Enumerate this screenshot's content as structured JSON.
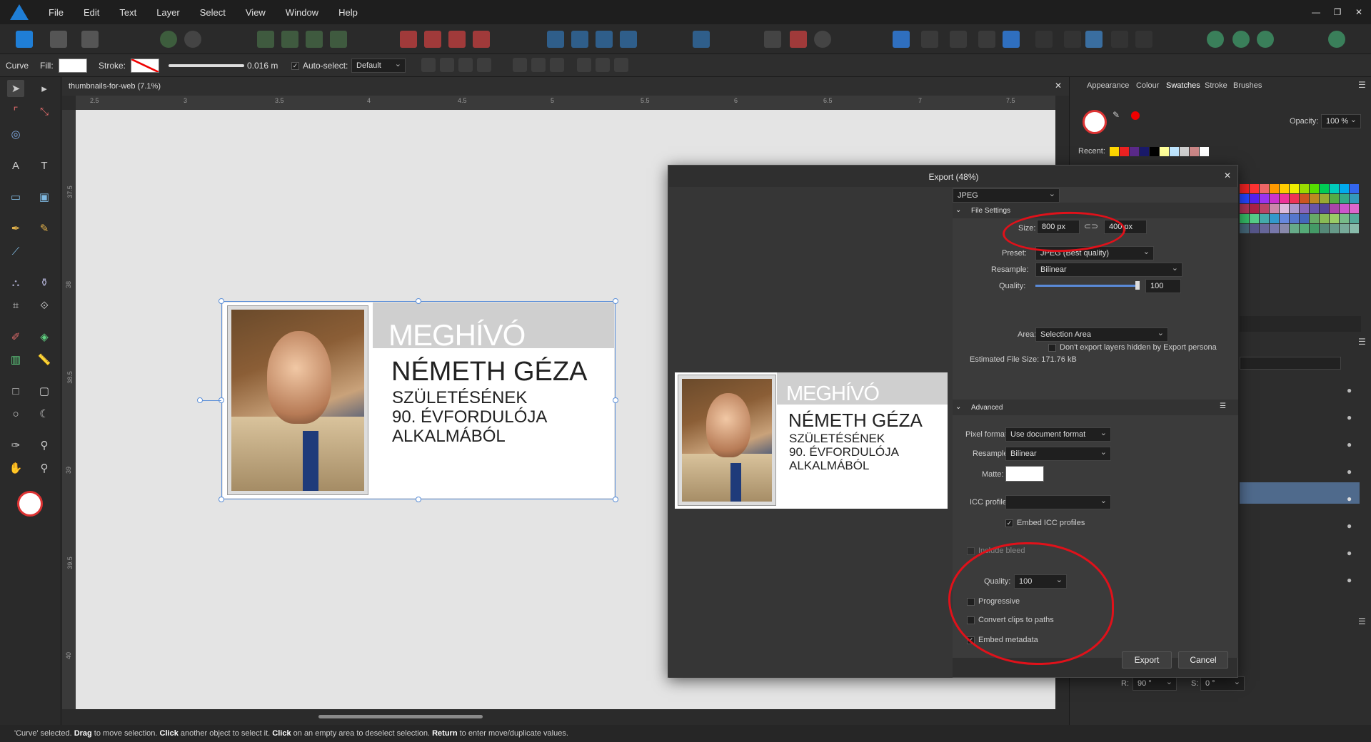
{
  "menubar": {
    "items": [
      "File",
      "Edit",
      "Text",
      "Layer",
      "Select",
      "View",
      "Window",
      "Help"
    ]
  },
  "context": {
    "tool_label": "Curve",
    "fill_label": "Fill:",
    "stroke_label": "Stroke:",
    "stroke_width": "0.016 m",
    "autoselect_label": "Auto-select:",
    "autoselect_value": "Default"
  },
  "document": {
    "tab_title": "thumbnails-for-web (7.1%)",
    "ruler_h": [
      "2.5",
      "3",
      "3.5",
      "4",
      "4.5",
      "5",
      "5.5",
      "6",
      "6.5",
      "7",
      "7.5"
    ],
    "ruler_v": [
      "37.5",
      "38",
      "38.5",
      "39",
      "39.5",
      "40"
    ]
  },
  "artwork": {
    "header": "MEGHÍVÓ",
    "name": "NÉMETH GÉZA",
    "line1": "SZÜLETÉSÉNEK",
    "line2": "90. ÉVFORDULÓJA",
    "line3": "ALKALMÁBÓL"
  },
  "right_panel": {
    "tabs": [
      "Appearance",
      "Colour",
      "Swatches",
      "Stroke",
      "Brushes"
    ],
    "active_tab": "Swatches",
    "opacity_label": "Opacity:",
    "opacity_value": "100 %",
    "recent_label": "Recent:",
    "r_label": "R:",
    "r_value": "90 °",
    "s_label": "S:",
    "s_value": "0 °"
  },
  "export_dialog": {
    "title": "Export (48%)",
    "format": "JPEG",
    "file_settings_label": "File Settings",
    "size_label": "Size:",
    "width": "800 px",
    "height": "400 px",
    "preset_label": "Preset:",
    "preset_value": "JPEG (Best quality)",
    "resample_label": "Resample:",
    "resample_value": "Bilinear",
    "quality_label": "Quality:",
    "quality_value": "100",
    "area_label": "Area:",
    "area_value": "Selection Area",
    "hidden_layers_label": "Don't export layers hidden by Export persona",
    "estimated_label": "Estimated File Size: 171.76 kB",
    "advanced_label": "Advanced",
    "pixel_format_label": "Pixel format:",
    "pixel_format_value": "Use document format",
    "adv_resample_label": "Resample:",
    "adv_resample_value": "Bilinear",
    "matte_label": "Matte:",
    "icc_label": "ICC profile:",
    "embed_icc_label": "Embed ICC profiles",
    "include_bleed_label": "Include bleed",
    "adv_quality_label": "Quality:",
    "adv_quality_value": "100",
    "progressive_label": "Progressive",
    "convert_clips_label": "Convert clips to paths",
    "embed_metadata_label": "Embed metadata",
    "export_button": "Export",
    "cancel_button": "Cancel"
  },
  "status": {
    "part1": "'Curve' selected. ",
    "drag": "Drag",
    "part2": " to move selection. ",
    "click1": "Click",
    "part3": " another object to select it. ",
    "click2": "Click",
    "part4": " on an empty area to deselect selection. ",
    "return": "Return",
    "part5": " to enter move/duplicate values."
  },
  "colors": {
    "accent": "#1f7ed6",
    "selection": "#5b8fd8",
    "annotation": "#e0111a"
  }
}
